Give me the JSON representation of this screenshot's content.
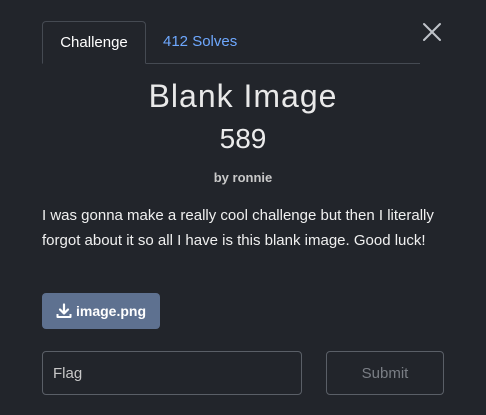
{
  "modal": {
    "tabs": [
      {
        "label": "Challenge",
        "active": true
      },
      {
        "label": "412 Solves",
        "active": false
      }
    ],
    "title": "Blank Image",
    "points": "589",
    "author": "by ronnie",
    "description": "I was gonna make a really cool challenge but then I literally forgot about it so all I have is this blank image. Good luck!",
    "file": {
      "label": "image.png",
      "icon": "download-icon"
    },
    "flag_input": {
      "placeholder": "Flag",
      "value": ""
    },
    "submit_label": "Submit",
    "close_icon": "close-icon"
  },
  "colors": {
    "background": "#22252b",
    "tab_link": "#6ea8fe",
    "file_button": "#5e7190",
    "border": "#454a52"
  }
}
